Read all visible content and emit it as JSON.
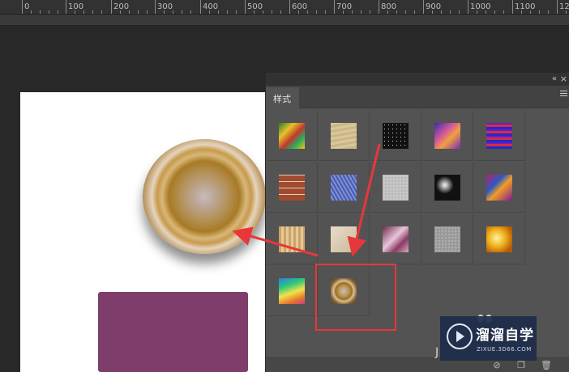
{
  "ruler": {
    "labels": [
      "0",
      "100",
      "200",
      "300",
      "400",
      "500",
      "600",
      "700",
      "800",
      "900",
      "1000",
      "1100",
      "12"
    ]
  },
  "canvas": {
    "disc_colors": [
      "#b4925a",
      "#a87a25",
      "#e5d5bd"
    ],
    "rect_color": "#7e3d6a"
  },
  "panel": {
    "tab_label": "样式",
    "collapse_icon": "«",
    "close_icon": "×",
    "menu_icon": "hamburger-menu-icon",
    "styles": [
      {
        "name": "style-rainbow-stripes",
        "selected": false
      },
      {
        "name": "style-parchment",
        "selected": false
      },
      {
        "name": "style-black-speckle",
        "selected": false
      },
      {
        "name": "style-purple-swirl",
        "selected": false
      },
      {
        "name": "style-blue-red-lines",
        "selected": false
      },
      {
        "name": "style-brick",
        "selected": false
      },
      {
        "name": "style-blue-weave",
        "selected": false
      },
      {
        "name": "style-white-stucco",
        "selected": false
      },
      {
        "name": "style-black-splatter",
        "selected": false
      },
      {
        "name": "style-colorful-shards",
        "selected": false
      },
      {
        "name": "style-wood",
        "selected": false
      },
      {
        "name": "style-beige-paper",
        "selected": false
      },
      {
        "name": "style-pink-satin",
        "selected": false
      },
      {
        "name": "style-gray-rock",
        "selected": false
      },
      {
        "name": "style-gold-gradient",
        "selected": false
      },
      {
        "name": "style-spectrum-gradient",
        "selected": false
      },
      {
        "name": "style-gold-ring",
        "selected": true
      }
    ],
    "footer_icons": [
      "no-style-icon",
      "new-style-icon",
      "trash-icon"
    ]
  },
  "annotation": {
    "arrow_color": "#e8373b"
  },
  "watermark": {
    "title": "溜溜自学",
    "url": "ZIXUE.3D66.COM",
    "partial_letter": "J"
  }
}
